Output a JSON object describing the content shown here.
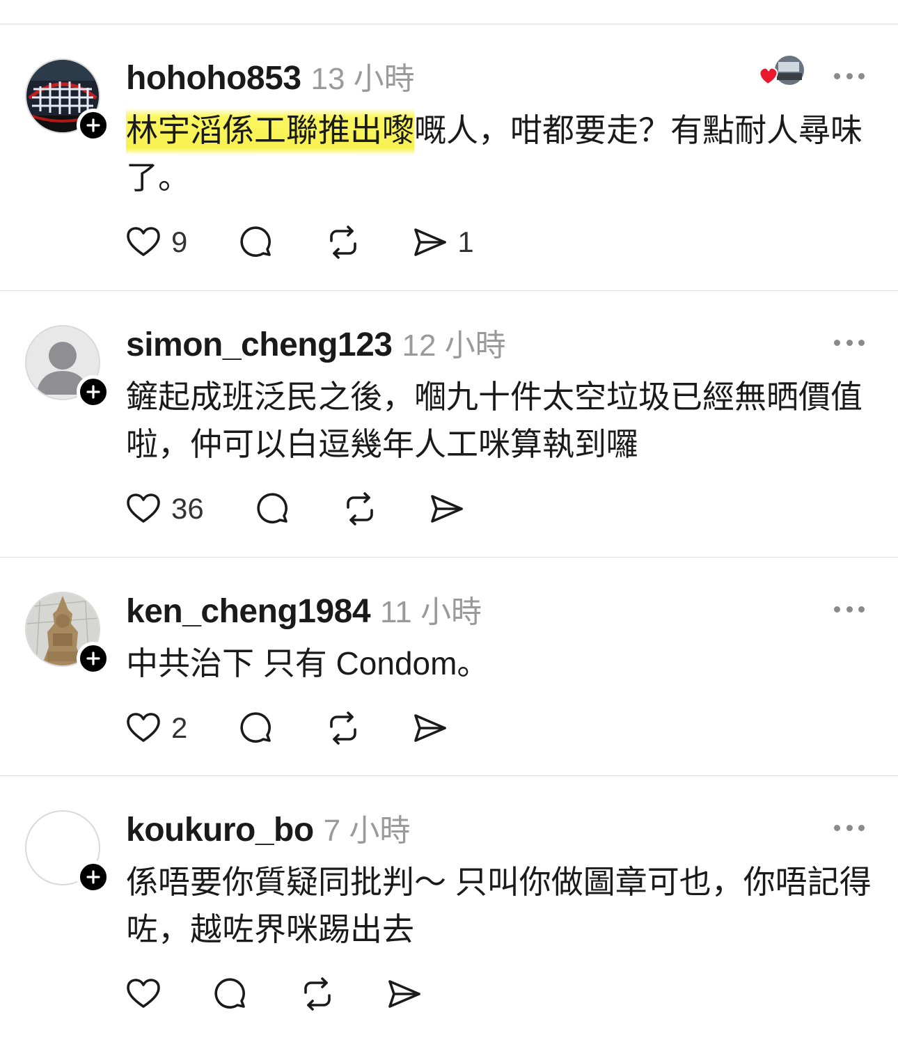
{
  "threads": [
    {
      "username": "hohoho853",
      "time": "13 小時",
      "text_highlight": "林宇滔係工聯推出嚟",
      "text_rest": "嘅人，咁都要走？有點耐人尋味了。",
      "likes": "9",
      "shares": "1",
      "liked_by_followed": true
    },
    {
      "username": "simon_cheng123",
      "time": "12 小時",
      "text": "鏟起成班泛民之後，嗰九十件太空垃圾已經無晒價值啦，仲可以白逗幾年人工咪算執到囉",
      "likes": "36"
    },
    {
      "username": "ken_cheng1984",
      "time": "11 小時",
      "text": "中共治下 只有 Condom。",
      "likes": "2"
    },
    {
      "username": "koukuro_bo",
      "time": "7 小時",
      "text": "係唔要你質疑同批判～ 只叫你做圖章可也，你唔記得咗，越咗界咪踢出去"
    }
  ],
  "icons": {
    "like": "heart-outline-icon",
    "reply": "speech-bubble-icon",
    "repost": "repost-arrows-icon",
    "share": "paper-plane-icon",
    "more": "more-dots-icon",
    "follow": "plus-icon",
    "liked_badge": "red-heart-icon"
  },
  "colors": {
    "text": "#1a1a1a",
    "muted": "#9a9a9a",
    "highlight": "#f6f03c",
    "heart": "#e8192c"
  }
}
